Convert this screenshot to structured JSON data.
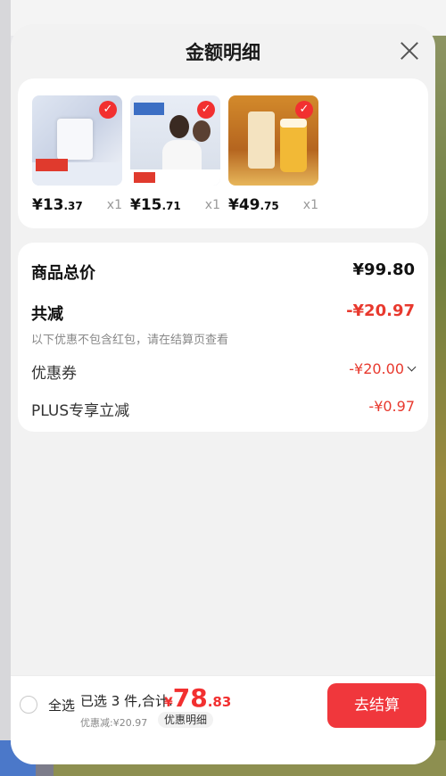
{
  "sheet": {
    "title": "金额明细"
  },
  "products": [
    {
      "price_int": "¥13",
      "price_dec": ".37",
      "qty": "x1"
    },
    {
      "price_int": "¥15",
      "price_dec": ".71",
      "qty": "x1"
    },
    {
      "price_int": "¥49",
      "price_dec": ".75",
      "qty": "x1"
    }
  ],
  "summary": {
    "total_label": "商品总价",
    "total_value": "¥99.80",
    "reduce_label": "共减",
    "reduce_value": "-¥20.97",
    "reduce_note": "以下优惠不包含红包，请在结算页查看",
    "coupon_label": "优惠券",
    "coupon_value": "-¥20.00",
    "plus_label": "PLUS专享立减",
    "plus_value": "-¥0.97"
  },
  "footer": {
    "select_all": "全选",
    "selected_text": "已选 3 件,合计:",
    "currency": "¥",
    "amount_int": "78",
    "amount_dec": ".83",
    "discount_text": "优惠减:¥20.97",
    "detail_button": "优惠明细",
    "checkout_button": "去结算"
  },
  "colors": {
    "accent_red": "#f0373c",
    "price_red": "#e8392e"
  }
}
